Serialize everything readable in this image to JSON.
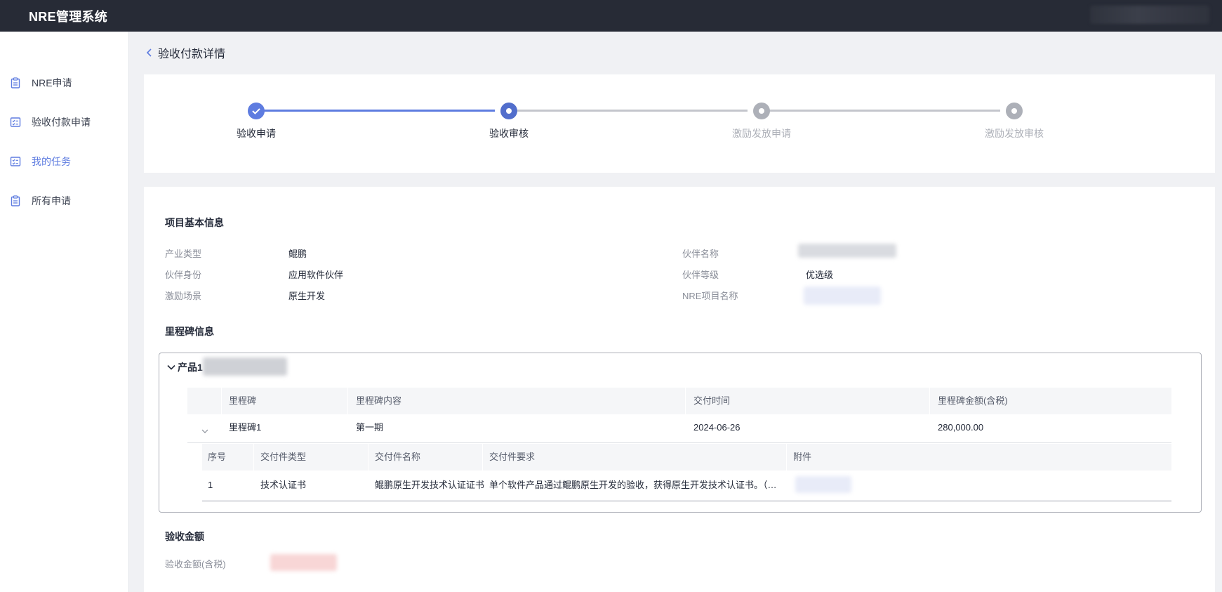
{
  "app": {
    "title": "NRE管理系统"
  },
  "sidebar": {
    "items": [
      {
        "label": "NRE申请",
        "icon": "clipboard-icon",
        "active": false
      },
      {
        "label": "验收付款申请",
        "icon": "checklist-icon",
        "active": false
      },
      {
        "label": "我的任务",
        "icon": "checklist-icon",
        "active": true
      },
      {
        "label": "所有申请",
        "icon": "clipboard-icon",
        "active": false
      }
    ]
  },
  "page": {
    "title": "验收付款详情"
  },
  "steps": {
    "items": [
      {
        "label": "验收申请",
        "state": "done"
      },
      {
        "label": "验收审核",
        "state": "current"
      },
      {
        "label": "激励发放申请",
        "state": "pending"
      },
      {
        "label": "激励发放审核",
        "state": "pending"
      }
    ]
  },
  "basic_info": {
    "title": "项目基本信息",
    "left": [
      {
        "label": "产业类型",
        "value": "鲲鹏"
      },
      {
        "label": "伙伴身份",
        "value": "应用软件伙伴"
      },
      {
        "label": "激励场景",
        "value": "原生开发"
      }
    ],
    "right": [
      {
        "label": "伙伴名称",
        "value": ""
      },
      {
        "label": "伙伴等级",
        "value": "优选级"
      },
      {
        "label": "NRE项目名称",
        "value": ""
      }
    ]
  },
  "milestones": {
    "title": "里程碑信息",
    "product_title": "产品1",
    "columns": [
      "里程碑",
      "里程碑内容",
      "交付时间",
      "里程碑金额(含税)"
    ],
    "rows": [
      {
        "name": "里程碑1",
        "content": "第一期",
        "date": "2024-06-26",
        "amount": "280,000.00"
      }
    ],
    "deliverable_columns": [
      "序号",
      "交付件类型",
      "交付件名称",
      "交付件要求",
      "附件"
    ],
    "deliverables": [
      {
        "index": "1",
        "type": "技术认证书",
        "name": "鲲鹏原生开发技术认证证书",
        "requirement": "单个软件产品通过鲲鹏原生开发的验收，获得原生开发技术认证书。（举证材料：鲲鹏原生开发技术认证证书）",
        "attachment": ""
      }
    ]
  },
  "acceptance": {
    "title": "验收金额",
    "label": "验收金额(含税)",
    "value": ""
  },
  "colors": {
    "accent": "#5e7ce0",
    "step_current": "#526ecc",
    "step_pending": "#adb0b8",
    "topbar": "#272b36"
  }
}
